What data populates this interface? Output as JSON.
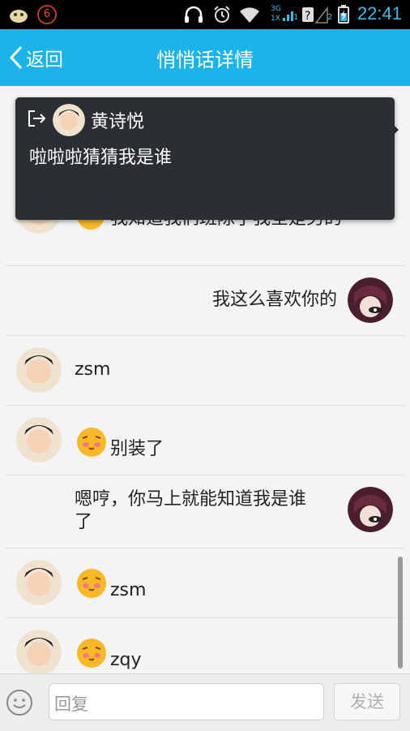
{
  "status_bar": {
    "time": "22:41",
    "notification_count": "6",
    "signal_labels": [
      "3G",
      "1X"
    ],
    "sim_slots": [
      "1",
      "2"
    ],
    "icons": [
      "app-notification-icon",
      "headphones-icon",
      "alarm-clock-icon",
      "wifi-icon",
      "signal-icon",
      "no-sim-icon",
      "battery-icon"
    ]
  },
  "header": {
    "back_label": "返回",
    "title": "悄悄话详情"
  },
  "popup": {
    "name": "黄诗悦",
    "message": "啦啦啦猜猜我是谁"
  },
  "messages": [
    {
      "side": "left",
      "text": "我知道我们班除了我全是男的",
      "emoji": true,
      "partial": true
    },
    {
      "side": "right",
      "text": "我这么喜欢你的"
    },
    {
      "side": "left",
      "text": "zsm"
    },
    {
      "side": "left",
      "text": "别装了",
      "emoji": true
    },
    {
      "side": "right",
      "text_line1": "嗯哼，你马上就能知道我是谁",
      "text_line2": "了"
    },
    {
      "side": "left",
      "text": "zsm",
      "emoji": true
    },
    {
      "side": "left",
      "text": "zqy",
      "emoji": true
    }
  ],
  "bottom_bar": {
    "input_placeholder": "回复",
    "send_label": "发送"
  },
  "colors": {
    "header_bg": "#1cb3e9",
    "popup_bg": "#2b2e33",
    "time_color": "#3fb9ec"
  }
}
